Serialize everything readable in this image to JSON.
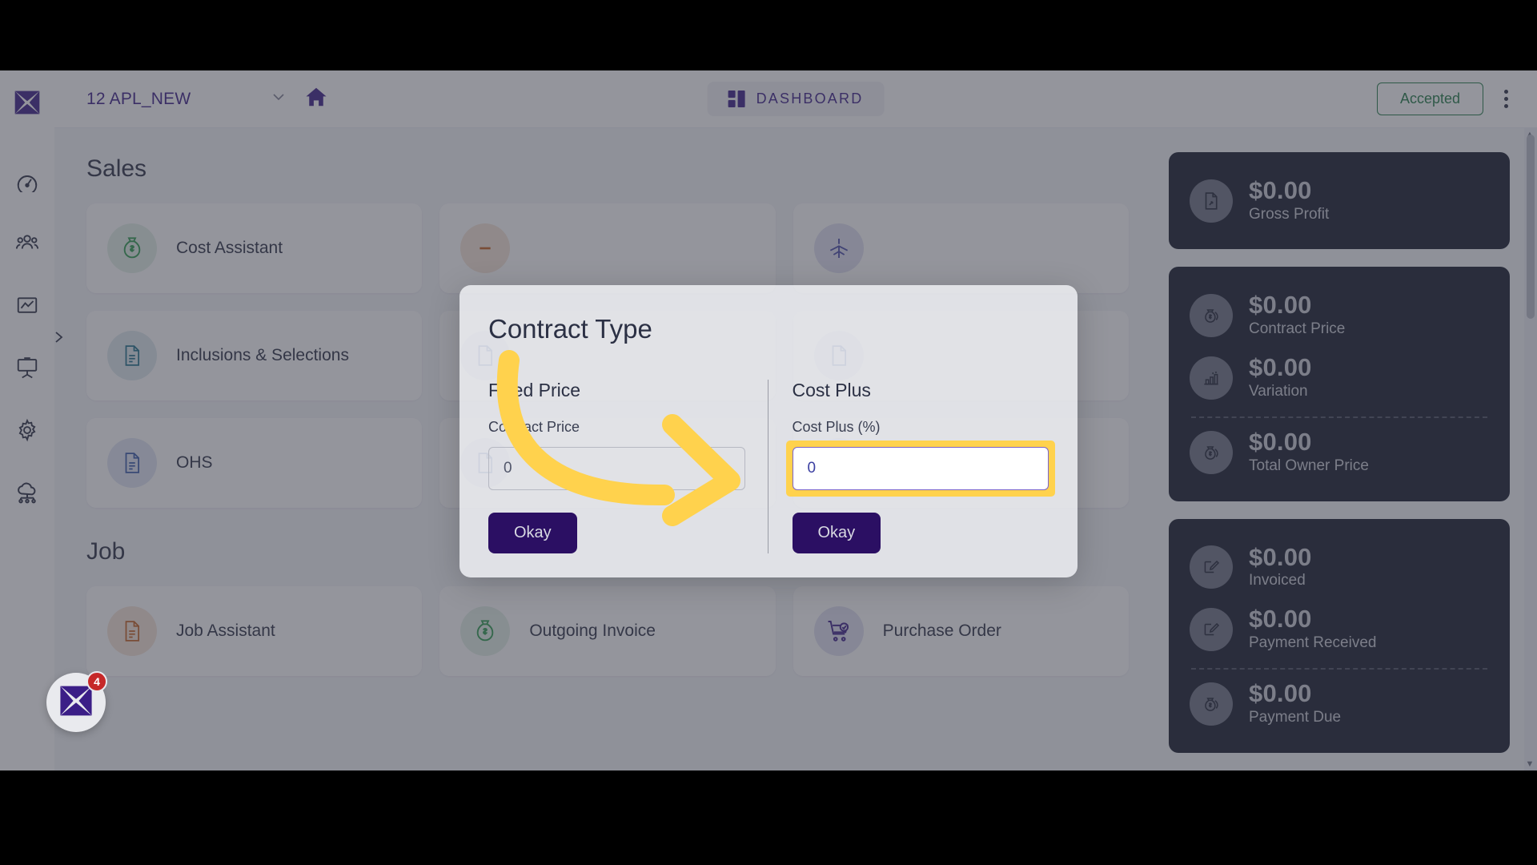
{
  "topbar": {
    "project_name": "12 APL_NEW",
    "chevron_icon": "chevron-down-icon",
    "home_icon": "home-icon",
    "dashboard_label": "DASHBOARD",
    "dashboard_icon": "grid-icon",
    "status_label": "Accepted",
    "status_color": "#1f7a45",
    "kebab_icon": "more-vertical-icon"
  },
  "sidebar": {
    "logo_icon": "app-logo-icon",
    "expander_icon": "chevron-right-icon",
    "items": [
      {
        "name": "dashboard",
        "icon": "speedometer-icon"
      },
      {
        "name": "contacts",
        "icon": "people-icon"
      },
      {
        "name": "reports",
        "icon": "chart-frame-icon"
      },
      {
        "name": "presentation",
        "icon": "presentation-board-icon"
      },
      {
        "name": "settings",
        "icon": "gear-icon"
      },
      {
        "name": "cloud",
        "icon": "cloud-network-icon"
      }
    ],
    "fab": {
      "icon": "app-logo-icon",
      "badge_count": "4",
      "badge_color": "#c62828"
    }
  },
  "main": {
    "sections": [
      {
        "title": "Sales",
        "tiles": [
          {
            "label": "Cost Assistant",
            "icon": "money-bag-icon",
            "icon_color": "#2e9b4f",
            "bg": "#e2f0e6"
          },
          {
            "label": "",
            "icon": "minus-doc-icon",
            "icon_color": "#c4601f",
            "bg": "#f6e4d8"
          },
          {
            "label": "",
            "icon": "plane-icon",
            "icon_color": "#4a4da8",
            "bg": "#e0e1f2"
          },
          {
            "label": "Inclusions & Selections",
            "icon": "document-lines-icon",
            "icon_color": "#1e6f8a",
            "bg": "#dde8ee"
          },
          {
            "label": "",
            "icon": "document-icon",
            "icon_color": "#3558a8",
            "bg": "#dfe5f3"
          },
          {
            "label": "",
            "icon": "document-icon",
            "icon_color": "#3558a8",
            "bg": "#dfe5f3"
          },
          {
            "label": "OHS",
            "icon": "document-lines-icon",
            "icon_color": "#3558a8",
            "bg": "#dfe5f3"
          },
          {
            "label": "",
            "icon": "document-icon",
            "icon_color": "#3558a8",
            "bg": "#dfe5f3"
          },
          {
            "label": "",
            "icon": "document-icon",
            "icon_color": "#3558a8",
            "bg": "#dfe5f3"
          }
        ]
      },
      {
        "title": "Job",
        "tiles": [
          {
            "label": "Job Assistant",
            "icon": "document-lines-icon",
            "icon_color": "#c4601f",
            "bg": "#f6e4d8"
          },
          {
            "label": "Outgoing Invoice",
            "icon": "money-bag-icon",
            "icon_color": "#2e9b4f",
            "bg": "#e2f0e6"
          },
          {
            "label": "Purchase Order",
            "icon": "cart-check-icon",
            "icon_color": "#3b1e87",
            "bg": "#e0e1f2"
          }
        ]
      }
    ]
  },
  "stats": {
    "cards": [
      {
        "rows": [
          {
            "amount": "$0.00",
            "label": "Gross Profit",
            "icon": "document-dollar-icon",
            "divider_after": false
          }
        ]
      },
      {
        "rows": [
          {
            "amount": "$0.00",
            "label": "Contract Price",
            "icon": "money-bags-icon",
            "divider_after": false
          },
          {
            "amount": "$0.00",
            "label": "Variation",
            "icon": "bar-chart-icon",
            "divider_after": true
          },
          {
            "amount": "$0.00",
            "label": "Total Owner Price",
            "icon": "money-bags-icon",
            "divider_after": false
          }
        ]
      },
      {
        "rows": [
          {
            "amount": "$0.00",
            "label": "Invoiced",
            "icon": "invoice-edit-icon",
            "divider_after": false
          },
          {
            "amount": "$0.00",
            "label": "Payment Received",
            "icon": "invoice-edit-icon",
            "divider_after": true
          },
          {
            "amount": "$0.00",
            "label": "Payment Due",
            "icon": "money-bags-icon",
            "divider_after": false
          }
        ]
      }
    ]
  },
  "modal": {
    "title": "Contract Type",
    "fixed_price": {
      "heading": "Fixed Price",
      "field_label": "Contract Price",
      "input_value": "",
      "input_placeholder": "0",
      "okay_label": "Okay"
    },
    "cost_plus": {
      "heading": "Cost Plus",
      "field_label": "Cost Plus (%)",
      "input_value": "0",
      "input_placeholder": "0",
      "okay_label": "Okay",
      "highlight_color": "#ffd24d",
      "focused": true
    }
  },
  "annotation": {
    "arrow_icon": "curved-arrow-icon",
    "arrow_color": "#ffd24d"
  }
}
